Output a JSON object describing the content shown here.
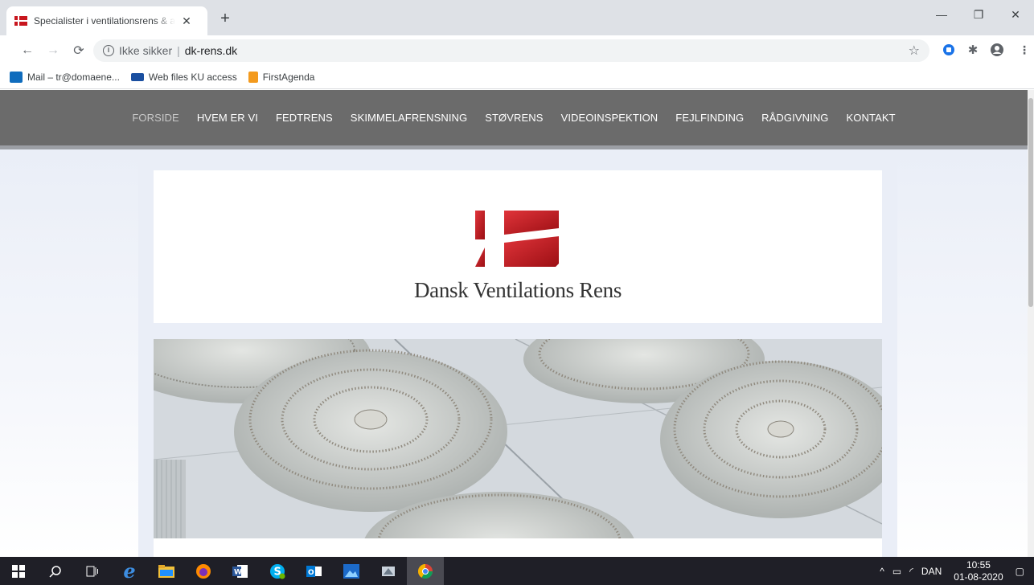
{
  "browser": {
    "tab_title": "Specialister i ventilationsrens & a",
    "tab_close": "✕",
    "new_tab": "+",
    "security_label": "Ikke sikker",
    "url": "dk-rens.dk",
    "window_controls": {
      "minimize": "—",
      "restore": "❐",
      "close": "✕"
    }
  },
  "bookmarks": [
    {
      "label": "Mail – tr@domaene...",
      "icon": "outlook-icon",
      "color": "#0f6cbd"
    },
    {
      "label": "Web files KU access",
      "icon": "ku-icon",
      "color": "#1a4fa0"
    },
    {
      "label": "FirstAgenda",
      "icon": "firstagenda-icon",
      "color": "#f39a1e"
    }
  ],
  "site": {
    "nav": [
      {
        "label": "FORSIDE",
        "active": true
      },
      {
        "label": "HVEM ER VI"
      },
      {
        "label": "FEDTRENS"
      },
      {
        "label": "SKIMMELAFRENSNING"
      },
      {
        "label": "STØVRENS"
      },
      {
        "label": "VIDEOINSPEKTION"
      },
      {
        "label": "FEJLFINDING"
      },
      {
        "label": "RÅDGIVNING"
      },
      {
        "label": "KONTAKT"
      }
    ],
    "brand_name": "Dansk Ventilations Rens",
    "colors": {
      "nav_bg": "#6b6b6b",
      "logo_red": "#c8161e"
    }
  },
  "taskbar": {
    "apps": [
      "windows-start-icon",
      "search-icon",
      "task-view-icon",
      "edge-icon",
      "file-explorer-icon",
      "firefox-icon",
      "word-icon",
      "skype-icon",
      "outlook-icon",
      "photos-icon",
      "snipping-icon",
      "chrome-icon"
    ],
    "language": "DAN",
    "time": "10:55",
    "date": "01-08-2020"
  }
}
